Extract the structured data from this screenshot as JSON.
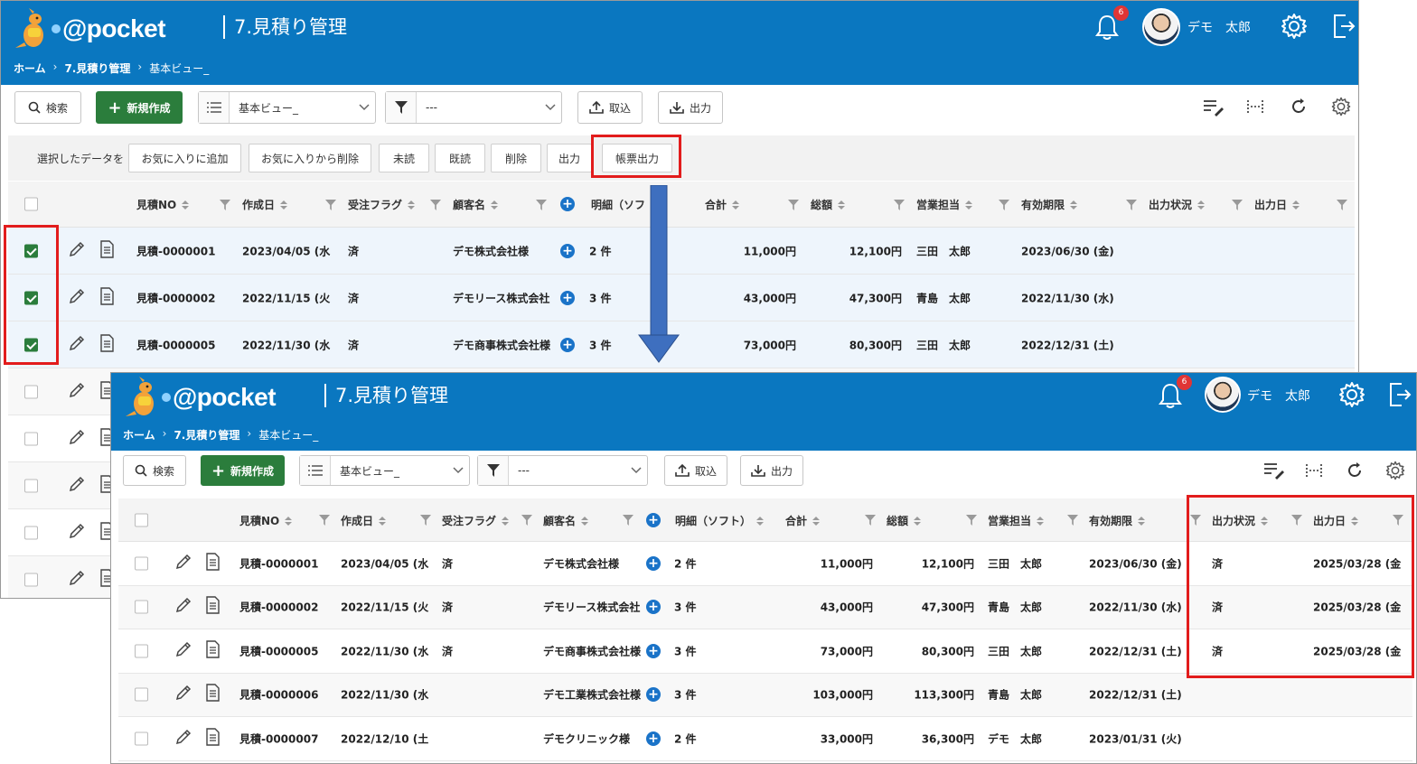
{
  "app": {
    "logo_text": "@pocket",
    "title": "7.見積り管理",
    "breadcrumb": [
      "ホーム",
      "7.見積り管理",
      "基本ビュー_"
    ],
    "notification_count": "6",
    "user_name": "デモ　太郎"
  },
  "toolbar": {
    "search_label": "検索",
    "new_label": "新規作成",
    "view_select": "基本ビュー_",
    "filter_select": "---",
    "import_label": "取込",
    "export_label": "出力"
  },
  "bulk_actions": {
    "label": "選択したデータを",
    "buttons": [
      "お気に入りに追加",
      "お気に入りから削除",
      "未読",
      "既読",
      "削除",
      "出力",
      "帳票出力"
    ]
  },
  "columns": [
    "見積NO",
    "作成日",
    "受注フラグ",
    "顧客名",
    "明細（ソフト）",
    "合計",
    "総額",
    "営業担当",
    "有効期限",
    "出力状況",
    "出力日"
  ],
  "before": {
    "col_detail_short": "明細（ソフ",
    "rows": [
      {
        "no": "見積-0000001",
        "date": "2023/04/05 (水",
        "flag": "済",
        "customer": "デモ株式会社様",
        "detail": "2 件",
        "total": "11,000円",
        "gross": "12,100円",
        "rep": "三田　太郎",
        "expiry": "2023/06/30 (金)",
        "checked": true
      },
      {
        "no": "見積-0000002",
        "date": "2022/11/15 (火",
        "flag": "済",
        "customer": "デモリース株式会社",
        "detail": "3 件",
        "total": "43,000円",
        "gross": "47,300円",
        "rep": "青島　太郎",
        "expiry": "2022/11/30 (水)",
        "checked": true
      },
      {
        "no": "見積-0000005",
        "date": "2022/11/30 (水",
        "flag": "済",
        "customer": "デモ商事株式会社様",
        "detail": "3 件",
        "total": "73,000円",
        "gross": "80,300円",
        "rep": "三田　太郎",
        "expiry": "2022/12/31 (土)",
        "checked": true
      }
    ]
  },
  "after": {
    "rows": [
      {
        "no": "見積-0000001",
        "date": "2023/04/05 (水",
        "flag": "済",
        "customer": "デモ株式会社様",
        "detail": "2 件",
        "total": "11,000円",
        "gross": "12,100円",
        "rep": "三田　太郎",
        "expiry": "2023/06/30 (金)",
        "status": "済",
        "out_date": "2025/03/28 (金"
      },
      {
        "no": "見積-0000002",
        "date": "2022/11/15 (火",
        "flag": "済",
        "customer": "デモリース株式会社",
        "detail": "3 件",
        "total": "43,000円",
        "gross": "47,300円",
        "rep": "青島　太郎",
        "expiry": "2022/11/30 (水)",
        "status": "済",
        "out_date": "2025/03/28 (金"
      },
      {
        "no": "見積-0000005",
        "date": "2022/11/30 (水",
        "flag": "済",
        "customer": "デモ商事株式会社様",
        "detail": "3 件",
        "total": "73,000円",
        "gross": "80,300円",
        "rep": "三田　太郎",
        "expiry": "2022/12/31 (土)",
        "status": "済",
        "out_date": "2025/03/28 (金"
      },
      {
        "no": "見積-0000006",
        "date": "2022/11/30 (水",
        "flag": "",
        "customer": "デモ工業株式会社様",
        "detail": "3 件",
        "total": "103,000円",
        "gross": "113,300円",
        "rep": "青島　太郎",
        "expiry": "2022/12/31 (土)",
        "status": "",
        "out_date": ""
      },
      {
        "no": "見積-0000007",
        "date": "2022/12/10 (土",
        "flag": "",
        "customer": "デモクリニック様",
        "detail": "2 件",
        "total": "33,000円",
        "gross": "36,300円",
        "rep": "デモ　太郎",
        "expiry": "2023/01/31 (火)",
        "status": "",
        "out_date": ""
      }
    ]
  },
  "colors": {
    "header": "#0a77c0",
    "primary_button": "#2b7d3c",
    "highlight": "#e21c1c",
    "arrow": "#3e6fbf"
  }
}
